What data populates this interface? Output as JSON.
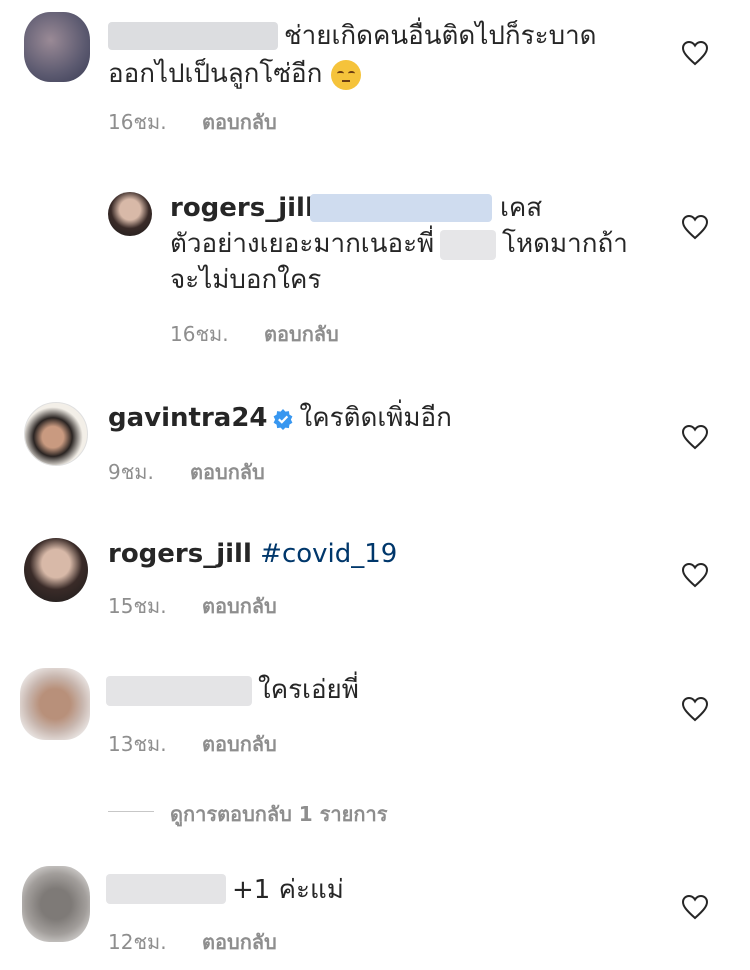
{
  "comments": [
    {
      "text_line1": "ช่ายเกิดคนอื่นติดไปก็ระบาด",
      "text_line2": "ออกไปเป็นลูกโซ่อีก",
      "emoji": "pensive-face-emoji",
      "time": "16ชม.",
      "reply": "ตอบกลับ"
    },
    {
      "username": "rogers_jill",
      "text_line1": "เคส",
      "text_line2a": "ตัวอย่างเยอะมากเนอะพี่",
      "text_line2b": "โหดมากถ้า",
      "text_line3": "จะไม่บอกใคร",
      "time": "16ชม.",
      "reply": "ตอบกลับ"
    },
    {
      "username": "gavintra24",
      "text": "ใครติดเพิ่มอีก",
      "time": "9ชม.",
      "reply": "ตอบกลับ"
    },
    {
      "username": "rogers_jill",
      "hashtag": "#covid_19",
      "time": "15ชม.",
      "reply": "ตอบกลับ"
    },
    {
      "text": "ใครเอ่ยพี่",
      "time": "13ชม.",
      "reply": "ตอบกลับ"
    },
    {
      "text": "+1 ค่ะแม่",
      "time": "12ชม.",
      "reply": "ตอบกลับ"
    }
  ],
  "view_replies": "ดูการตอบกลับ 1 รายการ",
  "colors": {
    "text": "#262626",
    "meta": "#8e8e8e",
    "hashtag": "#00376b",
    "verified": "#3897f0"
  }
}
